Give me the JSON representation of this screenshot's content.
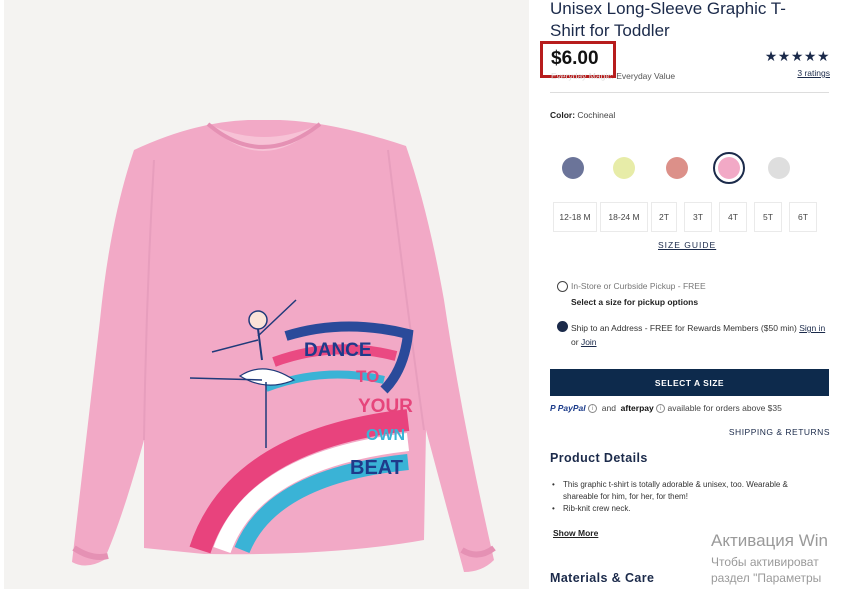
{
  "product": {
    "title": "Unisex Long-Sleeve Graphic T-Shirt for Toddler",
    "price": "$6.00",
    "magic_prefix": "Everyday Magic:",
    "magic_value": "Everyday Value",
    "stars": "★★★★★",
    "ratings": "3 ratings",
    "color_label": "Color:",
    "color_value": "Cochineal",
    "colors": {
      "swatch1": "#6b7499",
      "swatch2": "#e7eca8",
      "swatch3": "#dc9089",
      "swatch4_selected": "#f2a9c6",
      "swatch5": "#dedede"
    }
  },
  "graphic": {
    "line1": "DANCE",
    "line2": "TO",
    "line3": "YOUR",
    "line4": "OWN",
    "line5": "BEAT"
  },
  "sizes": [
    "12-18 M",
    "18-24 M",
    "2T",
    "3T",
    "4T",
    "5T",
    "6T"
  ],
  "size_guide": "SIZE GUIDE",
  "fulfillment": {
    "pickup_label": "In-Store or Curbside Pickup - FREE",
    "pickup_sub": "Select a size for pickup options",
    "ship_label": "Ship to an Address - FREE for Rewards Members ($50 min)",
    "sign_in": "Sign in",
    "or": "or",
    "join": "Join"
  },
  "cta": {
    "select_size": "SELECT A SIZE"
  },
  "payment": {
    "paypal": "PayPal",
    "and": "and",
    "afterpay": "afterpay",
    "available": "available for orders above $35"
  },
  "shipping_returns": "SHIPPING & RETURNS",
  "details": {
    "title": "Product Details",
    "bullets": [
      "This graphic t-shirt is totally adorable & unisex, too. Wearable & shareable for him, for her, for them!",
      "Rib-knit crew neck."
    ],
    "show_more": "Show More"
  },
  "materials_title": "Materials & Care",
  "watermark": {
    "line1": "Активация Win",
    "line2": "Чтобы активироват",
    "line3": "раздел \"Параметры"
  }
}
